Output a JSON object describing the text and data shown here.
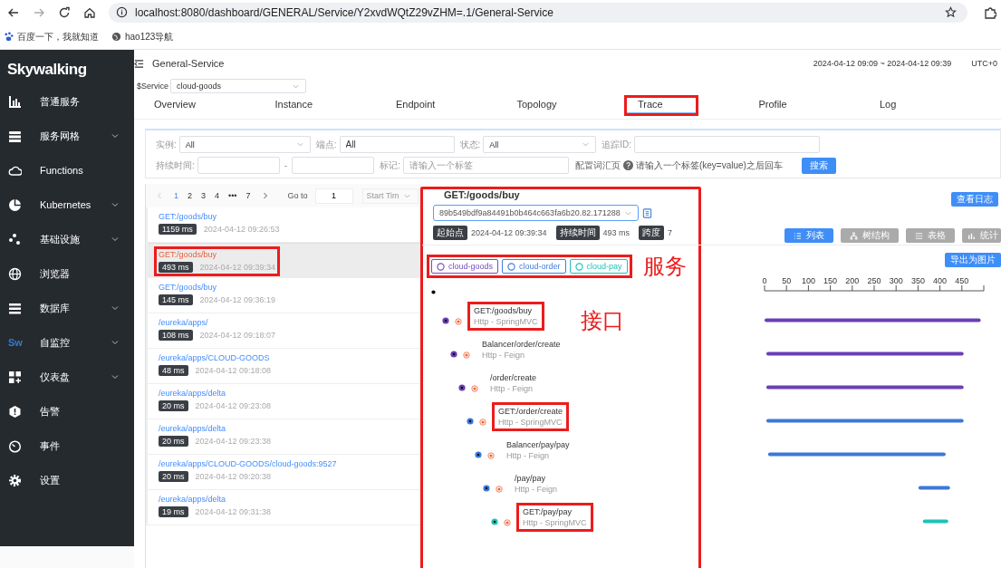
{
  "browser": {
    "url": "localhost:8080/dashboard/GENERAL/Service/Y2xvdWQtZ29vZHM=.1/General-Service",
    "bookmarks": [
      "百度一下，我就知道",
      "hao123导航"
    ]
  },
  "sidebar": {
    "logo": "Skywalking",
    "items": [
      {
        "label": "普通服务",
        "has_submenu": false
      },
      {
        "label": "服务网格",
        "has_submenu": true
      },
      {
        "label": "Functions",
        "has_submenu": false
      },
      {
        "label": "Kubernetes",
        "has_submenu": true
      },
      {
        "label": "基础设施",
        "has_submenu": true
      },
      {
        "label": "浏览器",
        "has_submenu": false
      },
      {
        "label": "数据库",
        "has_submenu": true
      },
      {
        "label": "自监控",
        "has_submenu": true,
        "icon_text": "Sw"
      },
      {
        "label": "仪表盘",
        "has_submenu": true
      },
      {
        "label": "告警",
        "has_submenu": false
      },
      {
        "label": "事件",
        "has_submenu": false
      },
      {
        "label": "设置",
        "has_submenu": false
      }
    ]
  },
  "header": {
    "title": "General-Service",
    "time_range": "2024-04-12 09:09 ~ 2024-04-12 09:39",
    "timezone": "UTC+0"
  },
  "service_select": {
    "label": "$Service",
    "value": "cloud-goods"
  },
  "tabs": [
    {
      "label": "Overview",
      "selected": false,
      "annotated": false
    },
    {
      "label": "Instance",
      "selected": false,
      "annotated": false
    },
    {
      "label": "Endpoint",
      "selected": false,
      "annotated": false
    },
    {
      "label": "Topology",
      "selected": false,
      "annotated": false
    },
    {
      "label": "Trace",
      "selected": true,
      "annotated": true
    },
    {
      "label": "Profile",
      "selected": false,
      "annotated": false
    },
    {
      "label": "Log",
      "selected": false,
      "annotated": false
    }
  ],
  "filters": {
    "instance": {
      "label": "实例:",
      "value": "All"
    },
    "endpoint": {
      "label": "端点:",
      "value": "All"
    },
    "status": {
      "label": "状态:",
      "value": "All"
    },
    "trace_id": {
      "label": "追踪ID:"
    },
    "duration": {
      "label": "持续时间:",
      "separator": "-"
    },
    "tags": {
      "label": "标记:",
      "placeholder": "请输入一个标签"
    },
    "vocabulary": "配置词汇页",
    "hint": "请输入一个标签(key=value)之后回车",
    "search_button": "搜索"
  },
  "pagination": {
    "pages": [
      {
        "label": "1",
        "selected": true
      },
      {
        "label": "2",
        "selected": false
      },
      {
        "label": "3",
        "selected": false
      },
      {
        "label": "4",
        "selected": false
      },
      {
        "label": "•••",
        "selected": false
      },
      {
        "label": "7",
        "selected": false
      }
    ],
    "goto_label": "Go to",
    "goto_value": "1",
    "sort": "Start Tim"
  },
  "traces": [
    {
      "endpoint": "GET:/goods/buy",
      "duration": "1159 ms",
      "time": "2024-04-12 09:26:53",
      "selected": false,
      "annotated": false
    },
    {
      "endpoint": "GET:/goods/buy",
      "duration": "493 ms",
      "time": "2024-04-12 09:39:34",
      "selected": true,
      "annotated": true
    },
    {
      "endpoint": "GET:/goods/buy",
      "duration": "145 ms",
      "time": "2024-04-12 09:36:19",
      "selected": false,
      "annotated": false
    },
    {
      "endpoint": "/eureka/apps/",
      "duration": "108 ms",
      "time": "2024-04-12 09:18:07",
      "selected": false,
      "annotated": false
    },
    {
      "endpoint": "/eureka/apps/CLOUD-GOODS",
      "duration": "48 ms",
      "time": "2024-04-12 09:18:08",
      "selected": false,
      "annotated": false
    },
    {
      "endpoint": "/eureka/apps/delta",
      "duration": "20 ms",
      "time": "2024-04-12 09:23:08",
      "selected": false,
      "annotated": false
    },
    {
      "endpoint": "/eureka/apps/delta",
      "duration": "20 ms",
      "time": "2024-04-12 09:23:38",
      "selected": false,
      "annotated": false
    },
    {
      "endpoint": "/eureka/apps/CLOUD-GOODS/cloud-goods:9527",
      "duration": "20 ms",
      "time": "2024-04-12 09:20:38",
      "selected": false,
      "annotated": false
    },
    {
      "endpoint": "/eureka/apps/delta",
      "duration": "19 ms",
      "time": "2024-04-12 09:31:38",
      "selected": false,
      "annotated": false
    }
  ],
  "detail": {
    "annotated": true,
    "title": "GET:/goods/buy",
    "trace_id": "89b549bdf9a84491b0b464c663fa6b20.82.171288",
    "start_label": "起始点",
    "start": "2024-04-12 09:39:34",
    "duration_label": "持续时间",
    "duration": "493 ms",
    "spans_label": "跨度",
    "spans_count": "7",
    "log_button": "查看日志",
    "views": [
      {
        "label": "列表",
        "selected": true
      },
      {
        "label": "树结构",
        "selected": false
      },
      {
        "label": "表格",
        "selected": false
      },
      {
        "label": "统计",
        "selected": false
      }
    ],
    "export_button": "导出为图片",
    "services": {
      "annotated": true,
      "note": "服务",
      "items": [
        {
          "name": "cloud-goods",
          "color": "#7a4cc0"
        },
        {
          "name": "cloud-order",
          "color": "#3f7fe0"
        },
        {
          "name": "cloud-pay",
          "color": "#1fc2b8"
        }
      ]
    },
    "spans": [
      {
        "name": "GET:/goods/buy",
        "type": "Http - SpringMVC",
        "color": "#6a3fb5",
        "annotated": true,
        "note": "接口",
        "children": [
          {
            "name": "Balancer/order/create",
            "type": "Http - Feign",
            "color": "#6a3fb5",
            "annotated": false,
            "children": [
              {
                "name": "/order/create",
                "type": "Http - Feign",
                "color": "#6a3fb5",
                "annotated": false,
                "children": [
                  {
                    "name": "GET:/order/create",
                    "type": "Http - SpringMVC",
                    "color": "#3c78d8",
                    "annotated": true,
                    "children": [
                      {
                        "name": "Balancer/pay/pay",
                        "type": "Http - Feign",
                        "color": "#3c78d8",
                        "annotated": false,
                        "children": [
                          {
                            "name": "/pay/pay",
                            "type": "Http - Feign",
                            "color": "#3c78d8",
                            "annotated": false,
                            "children": [
                              {
                                "name": "GET:/pay/pay",
                                "type": "Http - SpringMVC",
                                "color": "#1fc2b8",
                                "annotated": true
                              }
                            ]
                          }
                        ]
                      }
                    ]
                  }
                ]
              }
            ]
          }
        ]
      }
    ],
    "timeline": {
      "axis_labels": [
        "0",
        "50",
        "100",
        "150",
        "200",
        "250",
        "300",
        "350",
        "400",
        "450"
      ]
    }
  }
}
